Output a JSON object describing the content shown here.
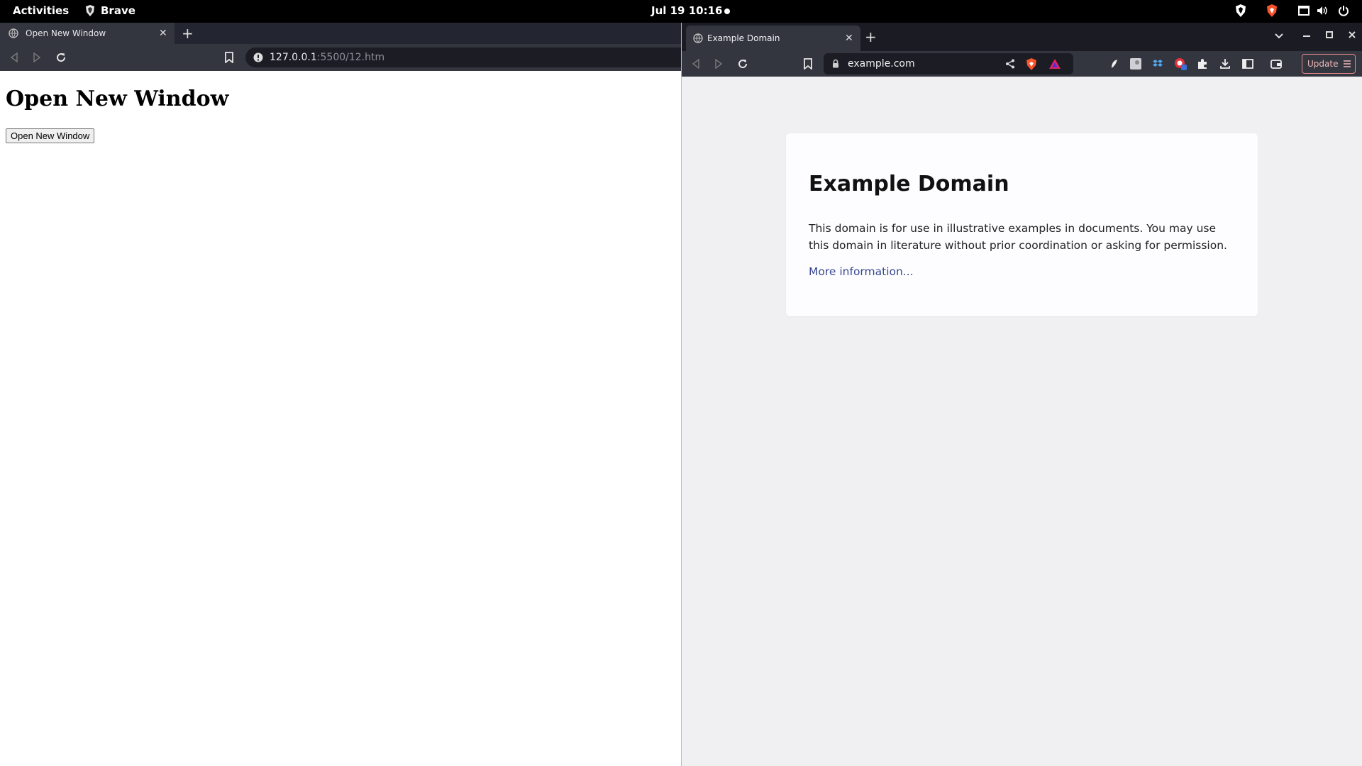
{
  "topbar": {
    "activities": "Activities",
    "app_name": "Brave",
    "clock": "Jul 19  10:16"
  },
  "left_window": {
    "tab_title": "Open New Window",
    "url_host": "127.0.0.1",
    "url_path": ":5500/12.htm",
    "page_heading": "Open New Window",
    "page_button": "Open New Window"
  },
  "right_window": {
    "tab_title": "Example Domain",
    "url": "example.com",
    "update_label": "Update",
    "page": {
      "heading": "Example Domain",
      "paragraph": "This domain is for use in illustrative examples in documents. You may use this domain in literature without prior coordination or asking for permission.",
      "link": "More information..."
    }
  },
  "colors": {
    "topbar": "#000000",
    "toolbar": "#33353f",
    "brave_orange": "#fb542b",
    "link": "#38488f",
    "update_border": "#e4898b"
  }
}
